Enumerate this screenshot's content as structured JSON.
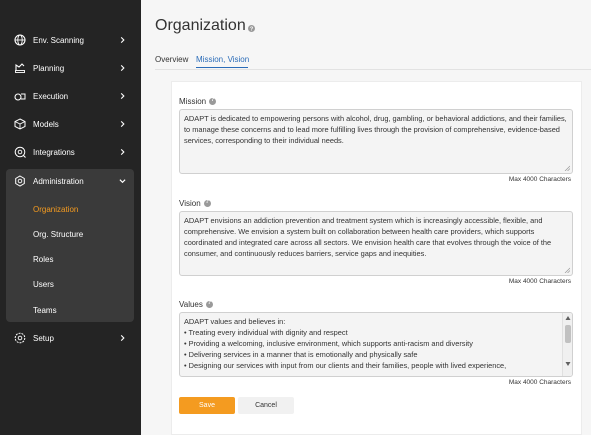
{
  "sidebar": {
    "items": [
      {
        "label": "Env. Scanning",
        "icon": "globe-icon"
      },
      {
        "label": "Planning",
        "icon": "planning-icon"
      },
      {
        "label": "Execution",
        "icon": "execution-icon"
      },
      {
        "label": "Models",
        "icon": "models-icon"
      },
      {
        "label": "Integrations",
        "icon": "integrations-icon"
      },
      {
        "label": "Administration",
        "icon": "admin-gear-icon"
      },
      {
        "label": "Setup",
        "icon": "setup-gear-icon"
      }
    ],
    "sub_items": [
      {
        "label": "Organization",
        "active": true
      },
      {
        "label": "Org. Structure"
      },
      {
        "label": "Roles"
      },
      {
        "label": "Users"
      },
      {
        "label": "Teams"
      }
    ]
  },
  "page": {
    "title": "Organization",
    "tabs": [
      {
        "label": "Overview"
      },
      {
        "label": "Mission, Vision",
        "active": true
      }
    ]
  },
  "form": {
    "mission": {
      "label": "Mission",
      "text": "ADAPT is dedicated to empowering persons with alcohol, drug, gambling, or behavioral addictions, and their families, to manage these concerns and to lead more fulfilling lives through the provision of comprehensive, evidence-based services, corresponding to their individual needs.",
      "max_note": "Max 4000 Characters"
    },
    "vision": {
      "label": "Vision",
      "text": "ADAPT envisions an addiction prevention and treatment system which is increasingly accessible, flexible, and comprehensive. We envision a system built on collaboration between health care providers, which supports coordinated and integrated care across all sectors. We envision health care that evolves through the voice of the consumer, and continuously reduces barriers, service gaps and inequities.",
      "max_note": "Max 4000 Characters"
    },
    "values": {
      "label": "Values",
      "lines": [
        "ADAPT values and believes in:",
        "• Treating every individual with dignity and respect",
        "• Providing a welcoming, inclusive environment, which supports anti-racism and diversity",
        "• Delivering services in a manner that is emotionally and physically safe",
        "• Designing our services with input from our clients and their families, people with lived experience,"
      ],
      "max_note": "Max 4000 Characters"
    },
    "save_label": "Save",
    "cancel_label": "Cancel"
  },
  "colors": {
    "sidebar_bg": "#242424",
    "accent_orange": "#f49b20",
    "tab_active_blue": "#2b6cb8"
  }
}
